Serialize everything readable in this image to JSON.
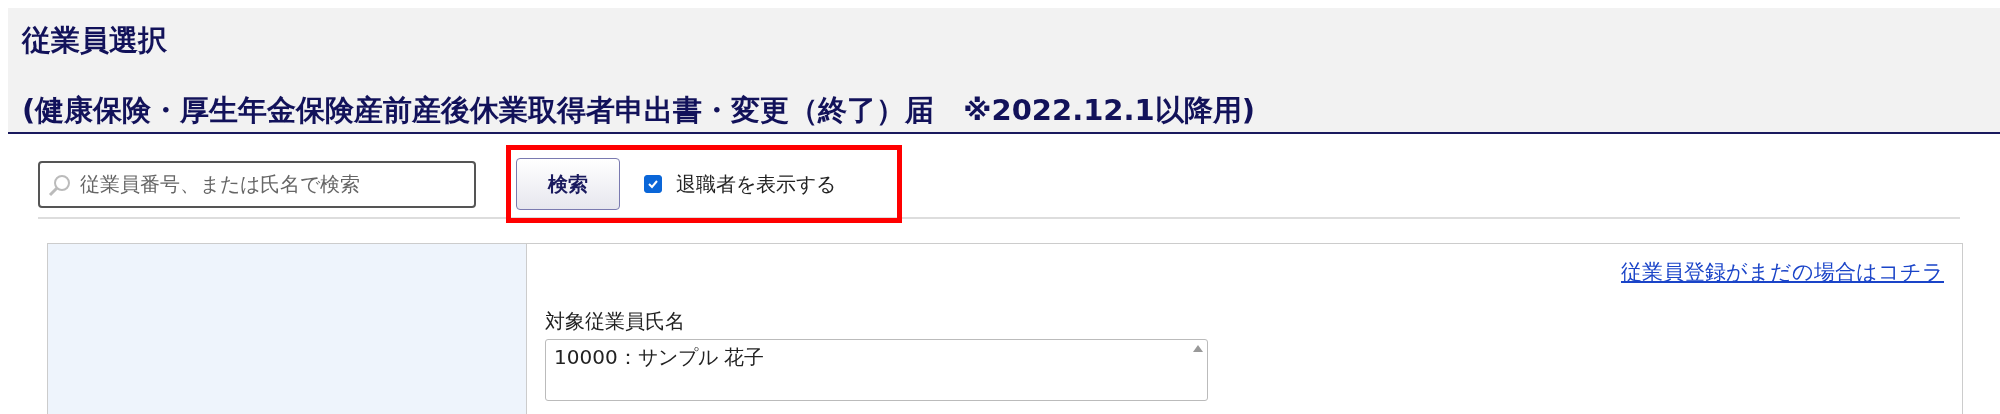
{
  "header": {
    "title": "従業員選択",
    "subtitle": "(健康保険・厚生年金保険産前産後休業取得者申出書・変更（終了）届　※2022.12.1以降用)"
  },
  "search": {
    "placeholder": "従業員番号、または氏名で検索",
    "button": "検索",
    "show_retired": {
      "label": "退職者を表示する",
      "checked": true
    }
  },
  "form": {
    "register_link": "従業員登録がまだの場合はコチラ",
    "employee_label": "対象従業員氏名",
    "employees": [
      {
        "label": "10000：サンプル 花子",
        "selected": false
      }
    ]
  }
}
